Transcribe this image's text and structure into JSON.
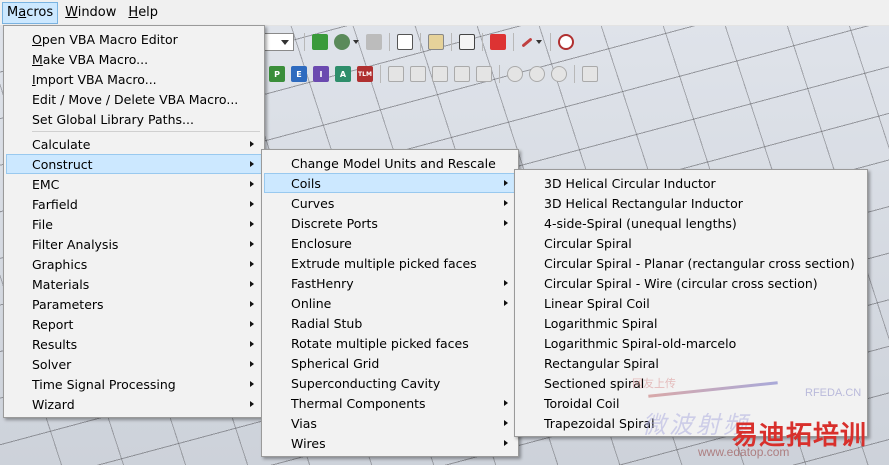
{
  "menubar": {
    "items": [
      {
        "pre": "M",
        "mn": "a",
        "post": "cros"
      },
      {
        "pre": "",
        "mn": "W",
        "post": "indow"
      },
      {
        "pre": "",
        "mn": "H",
        "post": "elp"
      }
    ]
  },
  "colors": {
    "highlight": "#cce8ff",
    "highlight_border": "#99c9ef",
    "menu_bg": "#f2f2f2",
    "watermark_brand": "#d8302c"
  },
  "macros_menu": {
    "group1": [
      {
        "pre": "",
        "mn": "O",
        "post": "pen VBA Macro Editor"
      },
      {
        "pre": "",
        "mn": "M",
        "post": "ake VBA Macro..."
      },
      {
        "pre": "",
        "mn": "I",
        "post": "mport VBA Macro..."
      },
      {
        "pre": "Edit / Move / Delete VBA Macro...",
        "mn": "",
        "post": ""
      },
      {
        "pre": "Set Global Library Paths...",
        "mn": "",
        "post": ""
      }
    ],
    "group2": [
      "Calculate",
      "Construct",
      "EMC",
      "Farfield",
      "File",
      "Filter Analysis",
      "Graphics",
      "Materials",
      "Parameters",
      "Report",
      "Results",
      "Solver",
      "Time Signal Processing",
      "Wizard"
    ]
  },
  "construct_menu": {
    "items": [
      {
        "label": "Change Model Units and Rescale",
        "sub": false
      },
      {
        "label": "Coils",
        "sub": true
      },
      {
        "label": "Curves",
        "sub": true
      },
      {
        "label": "Discrete Ports",
        "sub": true
      },
      {
        "label": "Enclosure",
        "sub": false
      },
      {
        "label": "Extrude multiple picked faces",
        "sub": false
      },
      {
        "label": "FastHenry",
        "sub": true
      },
      {
        "label": "Online",
        "sub": true
      },
      {
        "label": "Radial Stub",
        "sub": false
      },
      {
        "label": "Rotate multiple picked faces",
        "sub": false
      },
      {
        "label": "Spherical Grid",
        "sub": false
      },
      {
        "label": "Superconducting Cavity",
        "sub": false
      },
      {
        "label": "Thermal Components",
        "sub": true
      },
      {
        "label": "Vias",
        "sub": true
      },
      {
        "label": "Wires",
        "sub": true
      }
    ]
  },
  "coils_menu": {
    "items": [
      "3D Helical Circular Inductor",
      "3D Helical Rectangular Inductor",
      "4-side-Spiral (unequal lengths)",
      "Circular Spiral",
      "Circular Spiral - Planar (rectangular cross section)",
      "Circular Spiral - Wire (circular cross section)",
      "Linear Spiral Coil",
      "Logarithmic Spiral",
      "Logarithmic Spiral-old-marcelo",
      "Rectangular Spiral",
      "Sectioned spiral",
      "Toroidal Coil",
      "Trapezoidal Spiral"
    ]
  },
  "toolbar_icons": {
    "row1": [
      "ruler-icon",
      "gear-icon",
      "copy-icon",
      "pick-icon",
      "chart-icon",
      "export-icon",
      "delete-icon",
      "probe-icon",
      "stop-icon"
    ],
    "row2": [
      {
        "icon": "p-icon",
        "label": "P",
        "color": "#3a8e3a"
      },
      {
        "icon": "e-icon",
        "label": "E",
        "color": "#2e6bbf"
      },
      {
        "icon": "i-icon",
        "label": "I",
        "color": "#6b4ab0"
      },
      {
        "icon": "a-icon",
        "label": "A",
        "color": "#2e8e6b"
      },
      {
        "icon": "tlm-icon",
        "label": "TLM",
        "color": "#b03030"
      }
    ]
  },
  "watermark": {
    "line1": "网友上传",
    "small_logo": "RFEDA.CN",
    "line2": "微波射频",
    "brand": "易迪拓培训",
    "url": "www.edatop.com"
  }
}
